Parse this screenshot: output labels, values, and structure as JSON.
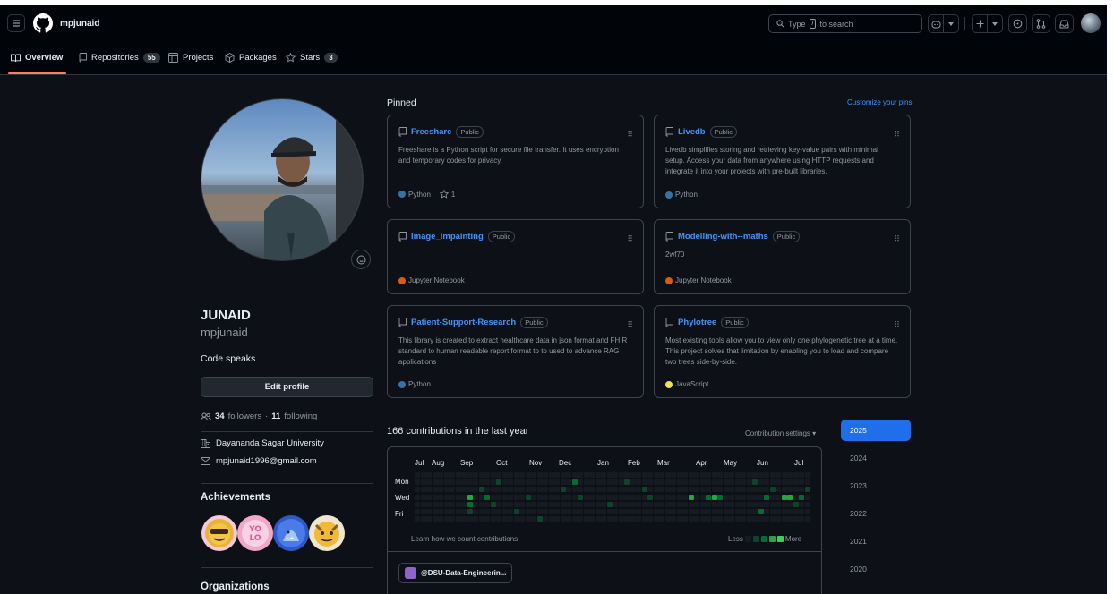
{
  "header": {
    "username": "mpjunaid",
    "search_text": "Type",
    "search_key": "/",
    "search_suffix": "to search"
  },
  "tabs": [
    {
      "label": "Overview"
    },
    {
      "label": "Repositories",
      "count": "55"
    },
    {
      "label": "Projects"
    },
    {
      "label": "Packages"
    },
    {
      "label": "Stars",
      "count": "3"
    }
  ],
  "profile": {
    "display_name": "JUNAID",
    "login": "mpjunaid",
    "bio": "Code speaks",
    "edit_button": "Edit profile",
    "followers": "34",
    "followers_label": "followers",
    "separator": "·",
    "following": "11",
    "following_label": "following",
    "organization": "Dayananda Sagar University",
    "email": "mpjunaid1996@gmail.com",
    "achievements_title": "Achievements",
    "organizations_title": "Organizations"
  },
  "pinned": {
    "title": "Pinned",
    "customize": "Customize your pins",
    "cards": [
      {
        "name": "Freeshare",
        "visibility": "Public",
        "description": "Freeshare is a Python script for secure file transfer. It uses encryption and temporary codes for privacy.",
        "language": "Python",
        "lang_color": "#3572A5",
        "stars": "1"
      },
      {
        "name": "Livedb",
        "visibility": "Public",
        "description": "Livedb simplifies storing and retrieving key-value pairs with minimal setup. Access your data from anywhere using HTTP requests and integrate it into your projects with pre-built libraries.",
        "language": "Python",
        "lang_color": "#3572A5"
      },
      {
        "name": "Image_impainting",
        "visibility": "Public",
        "description": "",
        "language": "Jupyter Notebook",
        "lang_color": "#DA5B0B"
      },
      {
        "name": "Modelling-with--maths",
        "visibility": "Public",
        "description": "2wf70",
        "language": "Jupyter Notebook",
        "lang_color": "#DA5B0B"
      },
      {
        "name": "Patient-Support-Research",
        "visibility": "Public",
        "description": "This library is created to extract healthcare data in json format and FHIR standard to human readable report format to to used to advance RAG applications",
        "language": "Python",
        "lang_color": "#3572A5"
      },
      {
        "name": "Phylotree",
        "visibility": "Public",
        "description": "Most existing tools allow you to view only one phylogenetic tree at a time. This project solves that limitation by enabling you to load and compare two trees side-by-side.",
        "language": "JavaScript",
        "lang_color": "#f1e05a"
      }
    ]
  },
  "contributions": {
    "title": "166 contributions in the last year",
    "settings": "Contribution settings",
    "months": [
      "Jul",
      "Aug",
      "Sep",
      "Oct",
      "Nov",
      "Dec",
      "Jan",
      "Feb",
      "Mar",
      "Apr",
      "May",
      "Jun",
      "Jul"
    ],
    "days": [
      "Mon",
      "Wed",
      "Fri"
    ],
    "learn": "Learn how we count contributions",
    "less": "Less",
    "more": "More",
    "colors": [
      "#161b22",
      "#0e4429",
      "#006d32",
      "#26a641",
      "#39d353"
    ],
    "org_chip": "@DSU-Data-Engineerin..."
  },
  "years": [
    "2025",
    "2024",
    "2023",
    "2022",
    "2021",
    "2020"
  ]
}
